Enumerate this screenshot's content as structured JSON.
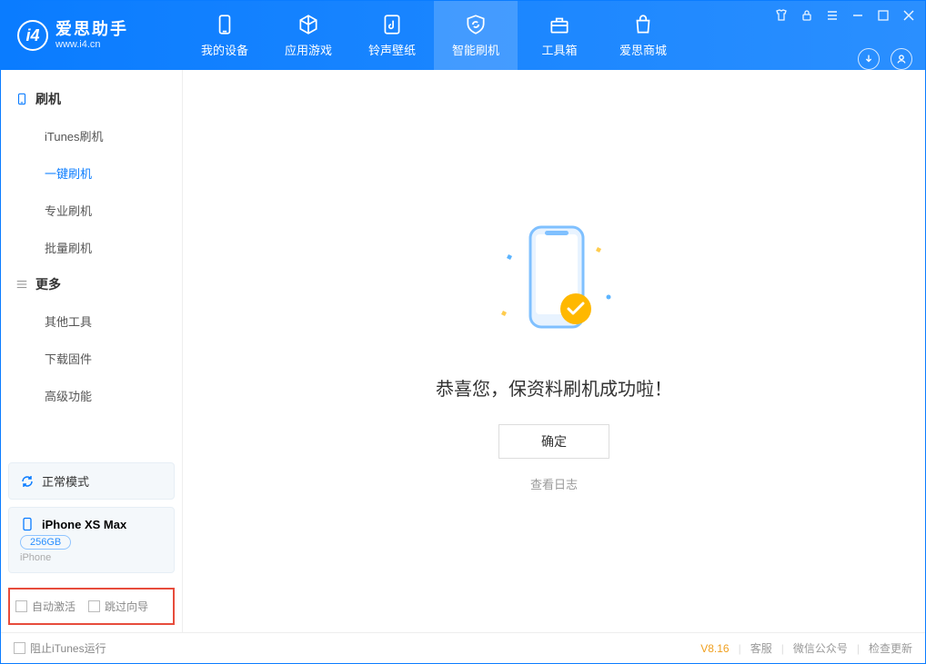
{
  "app": {
    "title": "爱思助手",
    "url": "www.i4.cn"
  },
  "nav": {
    "tabs": [
      {
        "label": "我的设备"
      },
      {
        "label": "应用游戏"
      },
      {
        "label": "铃声壁纸"
      },
      {
        "label": "智能刷机"
      },
      {
        "label": "工具箱"
      },
      {
        "label": "爱思商城"
      }
    ]
  },
  "sidebar": {
    "group1_title": "刷机",
    "group1_items": [
      "iTunes刷机",
      "一键刷机",
      "专业刷机",
      "批量刷机"
    ],
    "group2_title": "更多",
    "group2_items": [
      "其他工具",
      "下载固件",
      "高级功能"
    ],
    "mode_label": "正常模式",
    "device_name": "iPhone XS Max",
    "device_capacity": "256GB",
    "device_type": "iPhone",
    "opt_auto_activate": "自动激活",
    "opt_skip_guide": "跳过向导"
  },
  "main": {
    "success_title": "恭喜您，保资料刷机成功啦！",
    "ok_label": "确定",
    "view_log": "查看日志"
  },
  "statusbar": {
    "block_itunes": "阻止iTunes运行",
    "version": "V8.16",
    "customer_service": "客服",
    "wechat": "微信公众号",
    "check_update": "检查更新"
  }
}
